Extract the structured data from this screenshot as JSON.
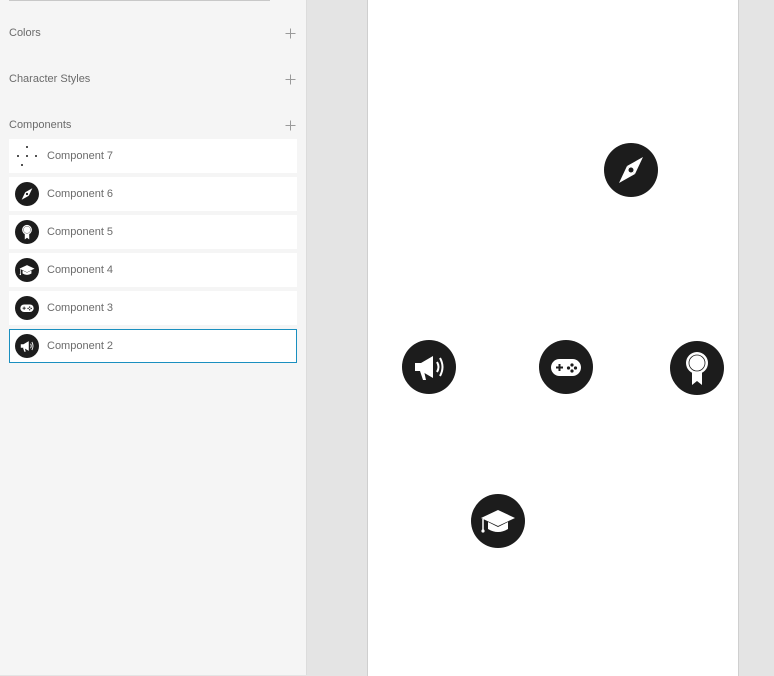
{
  "assets": {
    "sections": [
      {
        "title": "Colors",
        "add_icon": "plus-icon"
      },
      {
        "title": "Character Styles",
        "add_icon": "plus-icon"
      },
      {
        "title": "Components",
        "add_icon": "plus-icon"
      }
    ],
    "components": [
      {
        "label": "Component 7",
        "icon": "dots-icon",
        "selected": false
      },
      {
        "label": "Component 6",
        "icon": "compass-icon",
        "selected": false
      },
      {
        "label": "Component 5",
        "icon": "award-icon",
        "selected": false
      },
      {
        "label": "Component 4",
        "icon": "graduation-cap-icon",
        "selected": false
      },
      {
        "label": "Component 3",
        "icon": "gamepad-icon",
        "selected": false
      },
      {
        "label": "Component 2",
        "icon": "megaphone-icon",
        "selected": true
      }
    ]
  },
  "canvas": {
    "icons": [
      "compass-icon",
      "megaphone-icon",
      "gamepad-icon",
      "award-icon",
      "graduation-cap-icon"
    ]
  },
  "colors": {
    "selection": "#1a8fbf",
    "icon_fill": "#1c1c1c",
    "panel_bg": "#f5f5f5",
    "canvas_bg": "#e4e4e4",
    "artboard_bg": "#ffffff"
  }
}
